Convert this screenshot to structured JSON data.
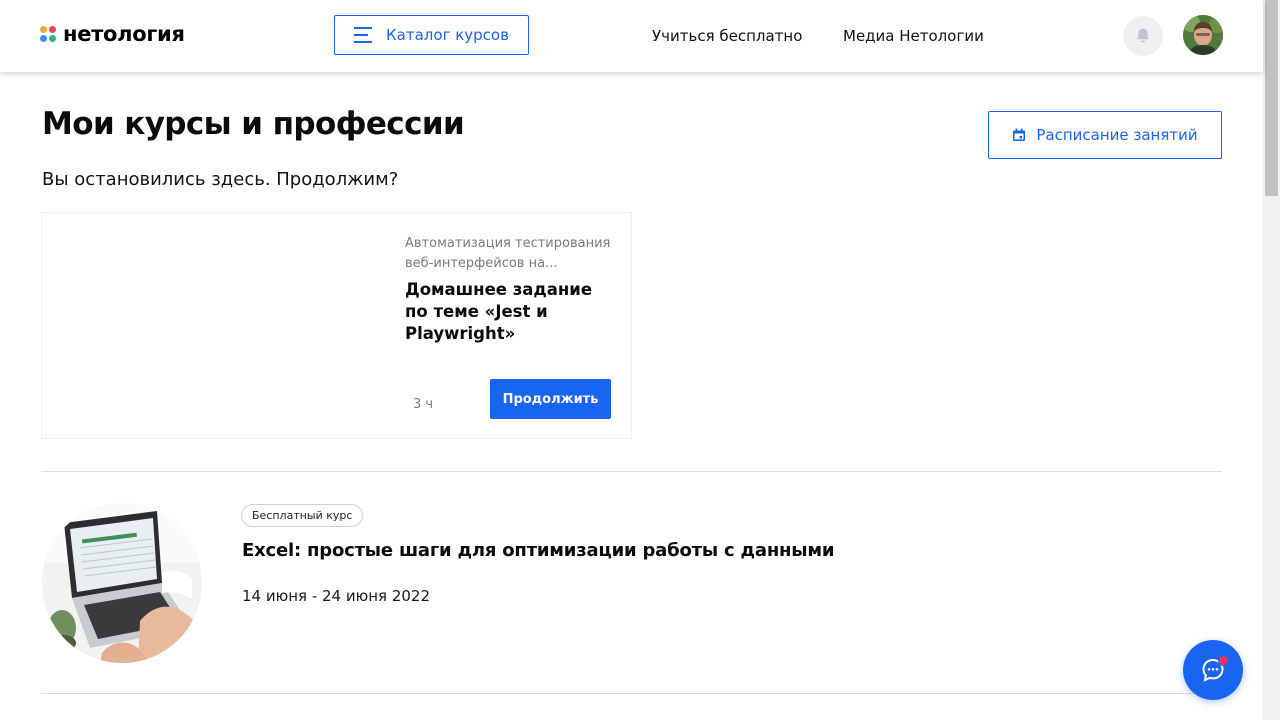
{
  "header": {
    "logo_text": "нетология",
    "catalog_label": "Каталог курсов",
    "nav": [
      "Учиться бесплатно",
      "Медиа Нетологии"
    ]
  },
  "main": {
    "title": "Мои курсы и профессии",
    "schedule_label": "Расписание занятий",
    "continue_heading": "Вы остановились здесь. Продолжим?",
    "resume_card": {
      "course": "Автоматизация тестирования веб-интерфейсов на...",
      "lesson": "Домашнее задание по теме «Jest и Playwright»",
      "time": "3 ч",
      "button_label": "Продолжить"
    },
    "courses": [
      {
        "badge": "Бесплатный курс",
        "title": "Excel: простые шаги для оптимизации работы с данными",
        "dates": "14 июня - 24 июня 2022"
      }
    ]
  },
  "icons": {
    "logo": "logo-icon",
    "catalog": "menu-icon",
    "bell": "bell-icon",
    "schedule": "calendar-icon",
    "chat": "chat-icon"
  },
  "colors": {
    "accent": "#1a64f2",
    "notification": "#f0315f"
  }
}
